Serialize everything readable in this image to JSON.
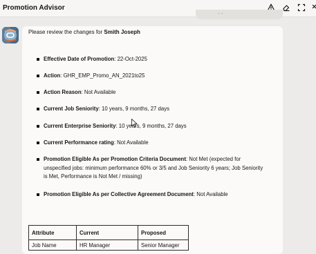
{
  "panel": {
    "title": "Promotion Advisor",
    "icons": [
      "warning-icon",
      "eraser-icon",
      "expand-icon",
      "close-icon"
    ]
  },
  "message": {
    "intro_prefix": "Please review the changes for ",
    "employee_name": "Smith Joseph",
    "items": [
      {
        "label": "Effective Date of Promotion",
        "value": ": 22-Oct-2025"
      },
      {
        "label": "Action",
        "value": ": GHR_EMP_Promo_AN_2021to25"
      },
      {
        "label": "Action Reason",
        "value": ": Not Available"
      },
      {
        "label": "Current Job Seniority",
        "value": ": 10 years, 9 months, 27 days"
      },
      {
        "label": "Current Enterprise Seniority",
        "value": ": 10 years, 9 months, 27 days"
      },
      {
        "label": "Current Performance rating",
        "value": ": Not Available"
      },
      {
        "label": "Promotion Eligible As per Promotion Criteria Document",
        "value": ": Not Met (expected for unspecified jobs: minimum performance 60% or 3/5 and Job Seniority 6 years; Job Seniority is Met, Performance is Not Met / missing)"
      },
      {
        "label": "Promotion Eligible As per Collective Agreement Document",
        "value": ": Not Available"
      }
    ],
    "table": {
      "headers": [
        "Attribute",
        "Current",
        "Proposed"
      ],
      "rows": [
        [
          "Job Name",
          "HR Manager",
          "Senior Manager"
        ]
      ]
    }
  },
  "colors": {
    "accent": "#4a6a86",
    "background": "#ecebea",
    "message_bg": "#fbfaf9"
  }
}
